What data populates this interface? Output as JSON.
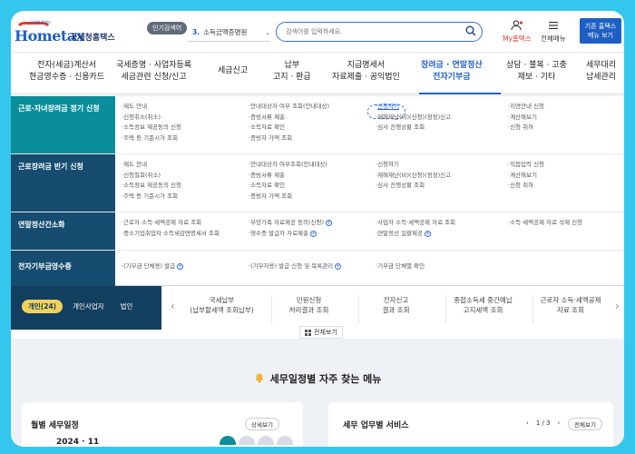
{
  "header": {
    "logo_tag": "국세청 홈택스",
    "logo_brand": "Hometax",
    "logo_korean": "국세청홈택스",
    "popular_badge": "인기검색어",
    "popular_num": "3.",
    "popular_text": "소득금액증명원",
    "search_placeholder": "검색어를 입력하세요.",
    "my_label": "My홈택스",
    "all_menu_label": "전체메뉴",
    "old_menu_line1": "기존 홈택스",
    "old_menu_line2": "메뉴 보기"
  },
  "gnb": [
    {
      "l1": "전자(세금)계산서",
      "l2": "현금영수증 · 신용카드"
    },
    {
      "l1": "국세증명 · 사업자등록",
      "l2": "세금관련 신청/신고"
    },
    {
      "l1": "세금신고",
      "l2": ""
    },
    {
      "l1": "납부",
      "l2": "고지 · 환급"
    },
    {
      "l1": "지급명세서",
      "l2": "자료제출 · 공익법인"
    },
    {
      "l1": "장려금 · 연말정산",
      "l2": "전자기부금"
    },
    {
      "l1": "상담 · 불복 · 고충",
      "l2": "제보 · 기타"
    },
    {
      "l1": "세무대리",
      "l2": "납세관리"
    }
  ],
  "mega": {
    "rows": [
      {
        "title": "근로·자녀장려금 정기 신청",
        "cols": [
          [
            "제도 안내",
            "신청취소(취소)",
            "소득정보 제공동의 신청",
            "주택 등 기준시가 조회"
          ],
          [
            "안내대상자 여부 조회(안내대상)",
            "증빙서류 제출",
            "소득자료 확인",
            "증빙자 가액 조회"
          ],
          [
            "신청하기",
            "재해재난(비)(신청)(정정)신고",
            "심사 진행상황 조회"
          ],
          [
            "지연안내 신청",
            "계산해보기",
            "신청 취하"
          ]
        ]
      },
      {
        "title": "근로장려금 반기 신청",
        "cols": [
          [
            "제도 안내",
            "신청철회(취소)",
            "소득정보 제공동의 신청",
            "주택 등 기준시가 조회"
          ],
          [
            "안내대상자 여부조회(안내대상)",
            "증빙서류 제출",
            "소득자료 확인",
            "증빙자 가액 조회"
          ],
          [
            "신청하기",
            "재해재난(비)(신청)(정정)신고",
            "심사 진행상황 조회"
          ],
          [
            "직접입력 신청",
            "계산해보기",
            "신청 취하"
          ]
        ]
      },
      {
        "title": "연말정산간소화",
        "cols": [
          [
            "근로자 소득·세액공제 자료 조회",
            "중소기업취업자 소득세감면명세서 조회"
          ],
          [
            "부양가족 자료제공 동의(신청)",
            "영수증 발급자 자료제출"
          ],
          [
            "사업자 소득·세액공제 자료 조회",
            "연말정산 일괄제공"
          ],
          [
            "소득·세액공제 자료 삭제 신청"
          ]
        ]
      },
      {
        "title": "전자기부금영수증",
        "cols": [
          [
            "(기부금 단체용) 발급"
          ],
          [
            "(기부자용) 발급 신청 및 목록관리"
          ],
          [
            "기부금 단체별 확인"
          ]
        ]
      }
    ]
  },
  "quick": {
    "tabs": [
      "개인(24)",
      "개인사업자",
      "법인"
    ],
    "items": [
      {
        "l1": "국세납부",
        "l2": "(납부할세액 조회납부)"
      },
      {
        "l1": "민원신청",
        "l2": "처리결과 조회"
      },
      {
        "l1": "전자신고",
        "l2": "결과 조회"
      },
      {
        "l1": "종합소득세 중간예납",
        "l2": "고지세액 조회"
      },
      {
        "l1": "근로자 소득·세액공제",
        "l2": "자료 조회"
      }
    ],
    "all_view": "전체보기"
  },
  "lower": {
    "faq_title": "세무일정별 자주 찾는 메뉴",
    "left_title": "월별 세무일정",
    "left_btn": "상세보기",
    "year": "2024 · 11",
    "right_title": "세무 업무별 서비스",
    "pager": "1 / 3",
    "right_btn": "전체보기"
  }
}
